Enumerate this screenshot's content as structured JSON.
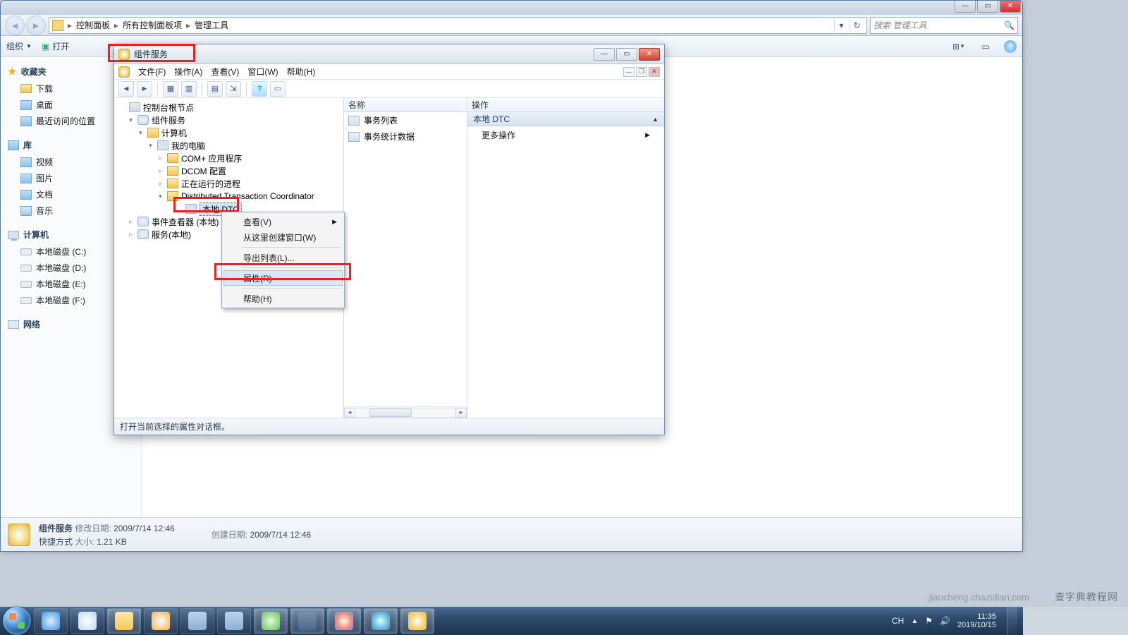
{
  "explorer": {
    "breadcrumbs": [
      "控制面板",
      "所有控制面板项",
      "管理工具"
    ],
    "search_placeholder": "搜索 管理工具",
    "toolbar": {
      "organize": "组织",
      "open": "打开"
    },
    "view_icons": {
      "layout": "⊞",
      "preview": "▭",
      "help": "?"
    },
    "side": {
      "favorites": {
        "title": "收藏夹",
        "items": [
          "下载",
          "桌面",
          "最近访问的位置"
        ]
      },
      "libraries": {
        "title": "库",
        "items": [
          "视频",
          "图片",
          "文档",
          "音乐"
        ]
      },
      "computer": {
        "title": "计算机",
        "items": [
          "本地磁盘 (C:)",
          "本地磁盘 (D:)",
          "本地磁盘 (E:)",
          "本地磁盘 (F:)"
        ]
      },
      "network": {
        "title": "网络"
      }
    },
    "details": {
      "name": "组件服务",
      "type": "快捷方式",
      "mod_label": "修改日期:",
      "mod_value": "2009/7/14 12:46",
      "size_label": "大小:",
      "size_value": "1.21 KB",
      "create_label": "创建日期:",
      "create_value": "2009/7/14 12:46"
    }
  },
  "mmc": {
    "title": "组件服务",
    "menus": [
      "文件(F)",
      "操作(A)",
      "查看(V)",
      "窗口(W)",
      "帮助(H)"
    ],
    "tree": {
      "root": "控制台根节点",
      "n1": "组件服务",
      "n2": "计算机",
      "n3": "我的电脑",
      "n4a": "COM+ 应用程序",
      "n4b": "DCOM 配置",
      "n4c": "正在运行的进程",
      "n4d": "Distributed Transaction Coordinator",
      "n5": "本地 DTC",
      "n6": "事件查看器 (本地)",
      "n7": "服务(本地)"
    },
    "mid": {
      "header": "名称",
      "items": [
        "事务列表",
        "事务统计数据"
      ]
    },
    "actions": {
      "header": "操作",
      "title": "本地 DTC",
      "more": "更多操作"
    },
    "status": "打开当前选择的属性对话框。"
  },
  "context_menu": {
    "view": "查看(V)",
    "new_window": "从这里创建窗口(W)",
    "export": "导出列表(L)...",
    "properties": "属性(R)",
    "help": "帮助(H)"
  },
  "tray": {
    "ime": "CH",
    "time": "11:35",
    "date": "2019/10/15"
  },
  "watermark": "查字典教程网",
  "watermark2": "jiaocheng.chazidian.com"
}
